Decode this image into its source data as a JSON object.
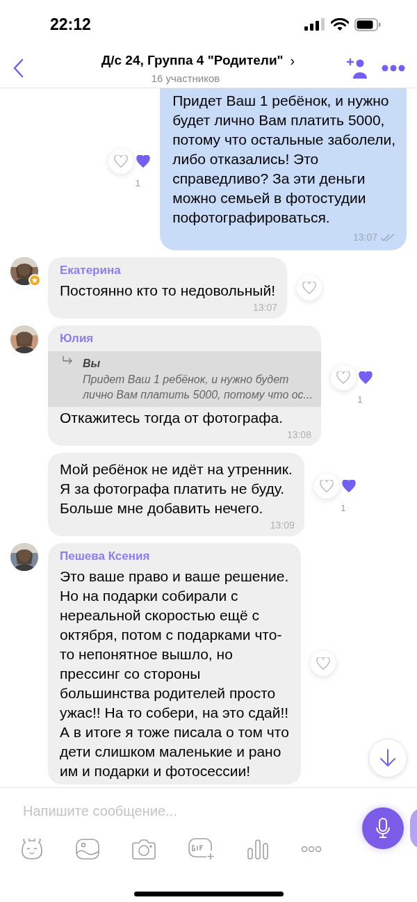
{
  "status_bar": {
    "time": "22:12"
  },
  "header": {
    "title": "Д/с 24, Группа 4 \"Родители\"",
    "chevron": "›",
    "subtitle": "16 участников"
  },
  "messages": [
    {
      "kind": "outgoing",
      "text": "Придет Ваш 1 ребёнок, и нужно\nбудет лично Вам платить 5000,\nпотому что остальные заболели,\nлибо отказались! Это\nсправедливо? За эти деньги\nможно семьей в фотостудии\nпофотографироваться.",
      "time": "13:07",
      "read": true,
      "reaction": {
        "hearted": true,
        "count": "1"
      }
    },
    {
      "kind": "incoming",
      "sender": "Екатерина",
      "admin": true,
      "text": "Постоянно кто то недовольный!",
      "time": "13:07",
      "reaction": {
        "hearted": false
      }
    },
    {
      "kind": "incoming",
      "sender": "Юлия",
      "admin": false,
      "reply": {
        "author": "Вы",
        "text": "Придет Ваш 1 ребёнок, и нужно будет\nлично Вам платить 5000, потому что ос..."
      },
      "text": "Откажитесь тогда от фотографа.",
      "time": "13:08",
      "reaction": {
        "hearted": true,
        "count": "1"
      }
    },
    {
      "kind": "incoming",
      "text": "Мой ребёнок не идёт на утренник.\nЯ за фотографа платить не буду.\nБольше мне добавить нечего.",
      "time": "13:09",
      "reaction": {
        "hearted": true,
        "count": "1"
      }
    },
    {
      "kind": "incoming",
      "sender": "Пешева Ксения",
      "admin": false,
      "text": "Это ваше право и ваше решение.\nНо на подарки собирали с\nнереальной скоростью ещё с\nоктября, потом с подарками что-\nто непонятное вышло, но\nпрессинг со стороны\nбольшинства родителей просто\nужас!! На то собери, на это сдай!!\nА в итоге я тоже писала о том что\nдети слишком маленькие и рано\nим и подарки и фотосессии!",
      "reaction": {
        "hearted": false
      }
    }
  ],
  "composer": {
    "placeholder": "Напишите сообщение..."
  }
}
